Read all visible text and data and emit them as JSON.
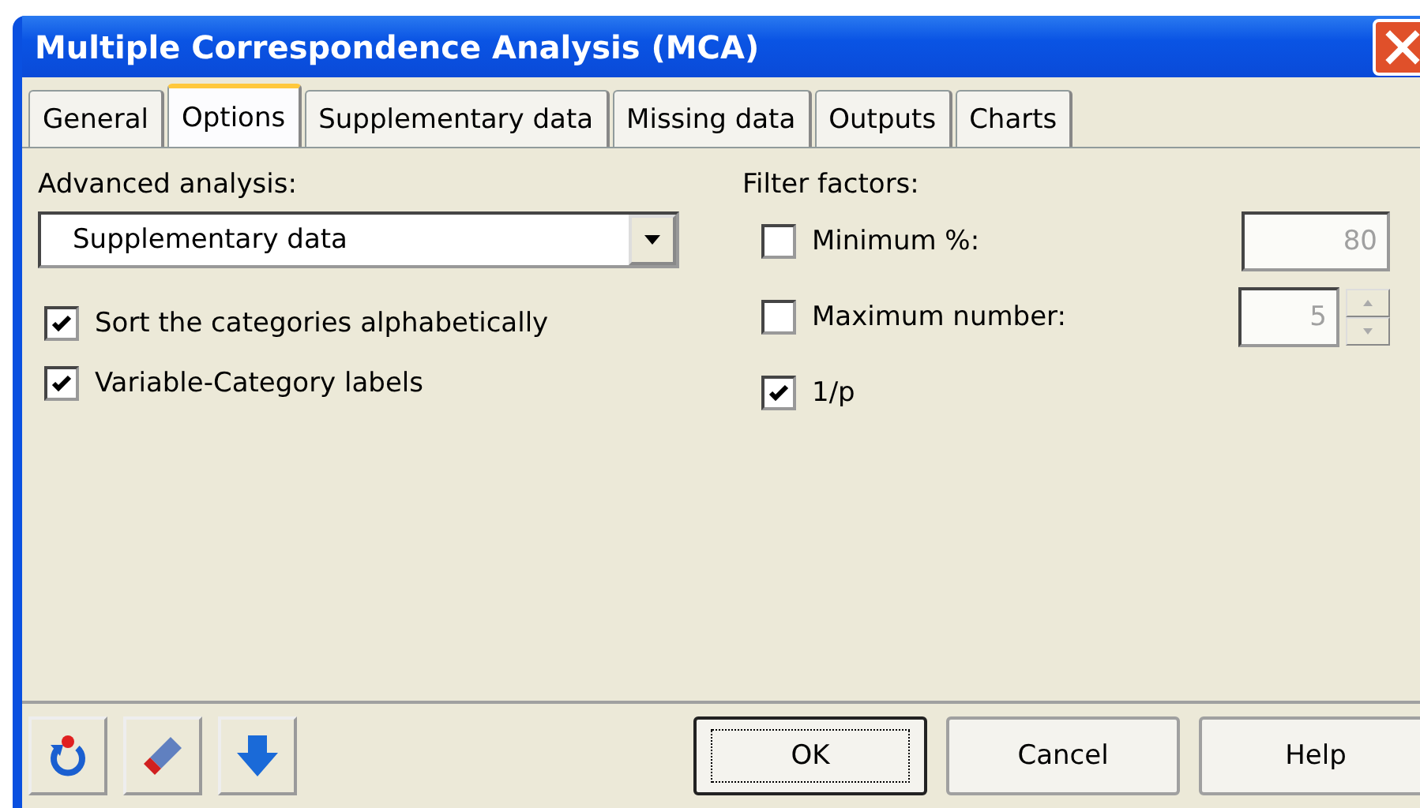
{
  "window": {
    "title": "Multiple Correspondence Analysis (MCA)"
  },
  "tabs": [
    {
      "label": "General",
      "selected": false
    },
    {
      "label": "Options",
      "selected": true
    },
    {
      "label": "Supplementary data",
      "selected": false
    },
    {
      "label": "Missing data",
      "selected": false
    },
    {
      "label": "Outputs",
      "selected": false
    },
    {
      "label": "Charts",
      "selected": false
    }
  ],
  "advanced_analysis": {
    "label": "Advanced analysis:",
    "value": "Supplementary data"
  },
  "options": [
    {
      "label": "Sort the categories alphabetically",
      "checked": true
    },
    {
      "label": "Variable-Category labels",
      "checked": true
    }
  ],
  "filter_factors": {
    "label": "Filter factors:",
    "items": [
      {
        "kind": "field",
        "label": "Minimum %:",
        "checked": false,
        "disabled": true,
        "value": "80"
      },
      {
        "kind": "spin",
        "label": "Maximum number:",
        "checked": false,
        "disabled": true,
        "value": "5"
      },
      {
        "kind": "plain",
        "label": "1/p",
        "checked": true
      }
    ]
  },
  "buttons": [
    {
      "label": "OK",
      "default": true
    },
    {
      "label": "Cancel",
      "default": false
    },
    {
      "label": "Help",
      "default": false
    }
  ]
}
